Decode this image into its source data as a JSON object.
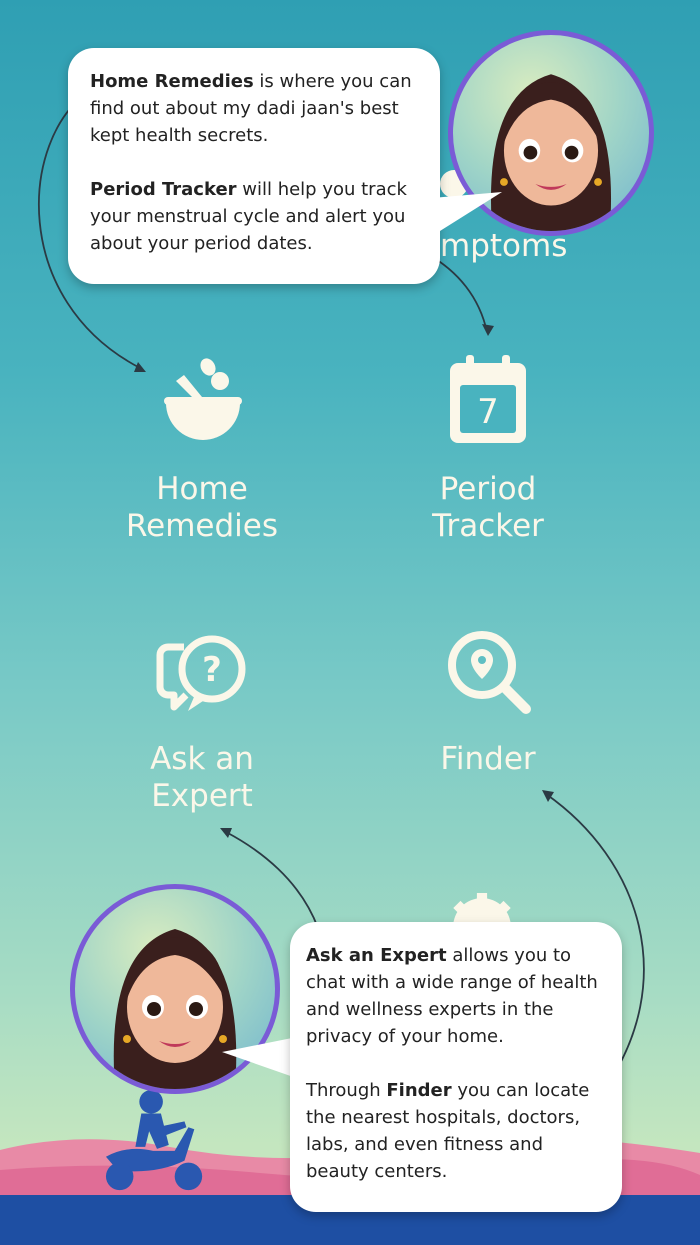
{
  "partial_tile": {
    "label": "mptoms"
  },
  "tiles": [
    {
      "label_line1": "Home",
      "label_line2": "Remedies",
      "icon": "bowl-leaves-icon"
    },
    {
      "label_line1": "Period",
      "label_line2": "Tracker",
      "icon": "calendar-icon",
      "calendar_day": "7"
    },
    {
      "label_line1": "Ask an",
      "label_line2": "Expert",
      "icon": "chat-question-icon"
    },
    {
      "label_line1": "Finder",
      "label_line2": "",
      "icon": "search-location-icon"
    }
  ],
  "bubble_top": {
    "p1_bold": "Home Remedies",
    "p1_text": " is where you can find out about my dadi jaan's best kept health secrets.",
    "p2_bold": "Period Tracker",
    "p2_text": " will help you track your menstrual cycle and alert you about your period dates."
  },
  "bubble_bottom": {
    "p1_bold": "Ask an Expert",
    "p1_text": " allows you to chat with a wide range of health and wellness experts in the privacy of your home.",
    "p2_pre": "Through ",
    "p2_bold": "Finder",
    "p2_text": " you can locate the nearest hospitals, doctors, labs, and even fitness and beauty centers."
  },
  "colors": {
    "tile_text": "#fbf7e9",
    "avatar_ring": "#7a5bd6",
    "footer": "#1e4fa3",
    "hills": "#e88aa6"
  }
}
